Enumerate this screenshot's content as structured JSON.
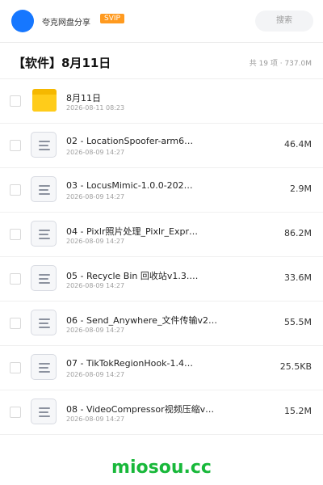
{
  "header": {
    "brand": "夸克网盘分享",
    "badge": "SVIP",
    "search": "搜索"
  },
  "folder": {
    "title": "【软件】8月11日",
    "meta": "共 19 项 · 737.0M"
  },
  "items": [
    {
      "name": "8月11日",
      "date": "2026-08-11 08:23",
      "size": "",
      "icon": "folder-icon"
    },
    {
      "name": "02 - LocationSpoofer-arm6…",
      "date": "2026-08-09 14:27",
      "size": "46.4M",
      "icon": "file-icon"
    },
    {
      "name": "03 - LocusMimic-1.0.0-202…",
      "date": "2026-08-09 14:27",
      "size": "2.9M",
      "icon": "file-icon"
    },
    {
      "name": "04 - Pixlr照片处理_Pixlr_Expr…",
      "date": "2026-08-09 14:27",
      "size": "86.2M",
      "icon": "file-icon"
    },
    {
      "name": "05 - Recycle Bin 回收站v1.3.…",
      "date": "2026-08-09 14:27",
      "size": "33.6M",
      "icon": "file-icon"
    },
    {
      "name": "06 - Send_Anywhere_文件传输v2…",
      "date": "2026-08-09 14:27",
      "size": "55.5M",
      "icon": "file-icon"
    },
    {
      "name": "07 - TikTokRegionHook-1.4…",
      "date": "2026-08-09 14:27",
      "size": "25.5KB",
      "icon": "file-icon"
    },
    {
      "name": "08 - VideoCompressor视频压缩v…",
      "date": "2026-08-09 14:27",
      "size": "15.2M",
      "icon": "file-icon"
    }
  ],
  "watermark": "miosou.cc",
  "colors": {
    "avatar": "#1677ff",
    "badge": "#ff9a1f",
    "folder": "#ffcc1a",
    "watermark": "#18b83a"
  }
}
